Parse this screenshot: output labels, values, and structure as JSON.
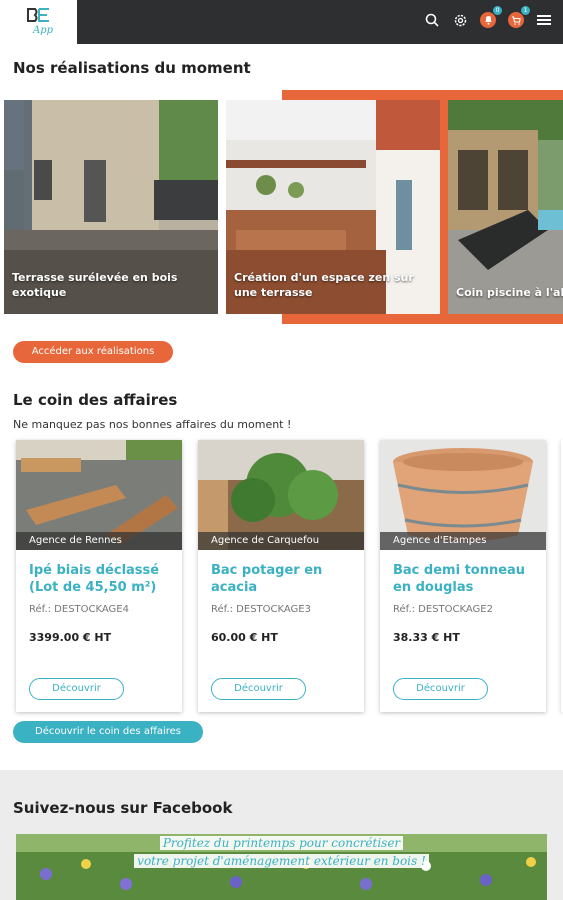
{
  "app": {
    "logo_text": "BE",
    "logo_sub": "App",
    "icon_names": [
      "search-icon",
      "settings-icon",
      "notification-icon",
      "cart-icon",
      "menu-icon"
    ]
  },
  "header": {
    "notif_badge": "0",
    "cart_badge": "1"
  },
  "realisations": {
    "title": "Nos réalisations du moment",
    "items": [
      {
        "caption": "Terrasse surélevée en bois exotique"
      },
      {
        "caption": "Création d'un espace zen sur une terrasse"
      },
      {
        "caption": "Coin piscine à l'abri et avec du rangem"
      }
    ],
    "button": "Accéder aux réalisations"
  },
  "affaires": {
    "title": "Le coin des affaires",
    "subtitle": "Ne manquez pas nos bonnes affaires du moment !",
    "items": [
      {
        "agency": "Agence de Rennes",
        "title": "Ipé biais déclassé (Lot de 45,50 m²)",
        "ref": "Réf.: DESTOCKAGE4",
        "price": "3399.00 € HT",
        "button": "Découvrir"
      },
      {
        "agency": "Agence de Carquefou",
        "title": "Bac potager en acacia",
        "ref": "Réf.: DESTOCKAGE3",
        "price": "60.00 € HT",
        "button": "Découvrir"
      },
      {
        "agency": "Agence d'Etampes",
        "title": "Bac demi tonneau en douglas",
        "ref": "Réf.: DESTOCKAGE2",
        "price": "38.33 € HT",
        "button": "Découvrir"
      }
    ],
    "button": "Découvrir le coin des affaires"
  },
  "facebook": {
    "title": "Suivez-nous sur Facebook",
    "post_line1": "Profitez du printemps pour concrétiser",
    "post_line2": "votre projet d'aménagement extérieur en bois !"
  },
  "colors": {
    "accent_orange": "#e8673a",
    "accent_teal": "#3bb1c4",
    "header_dark": "#2d2f31"
  }
}
